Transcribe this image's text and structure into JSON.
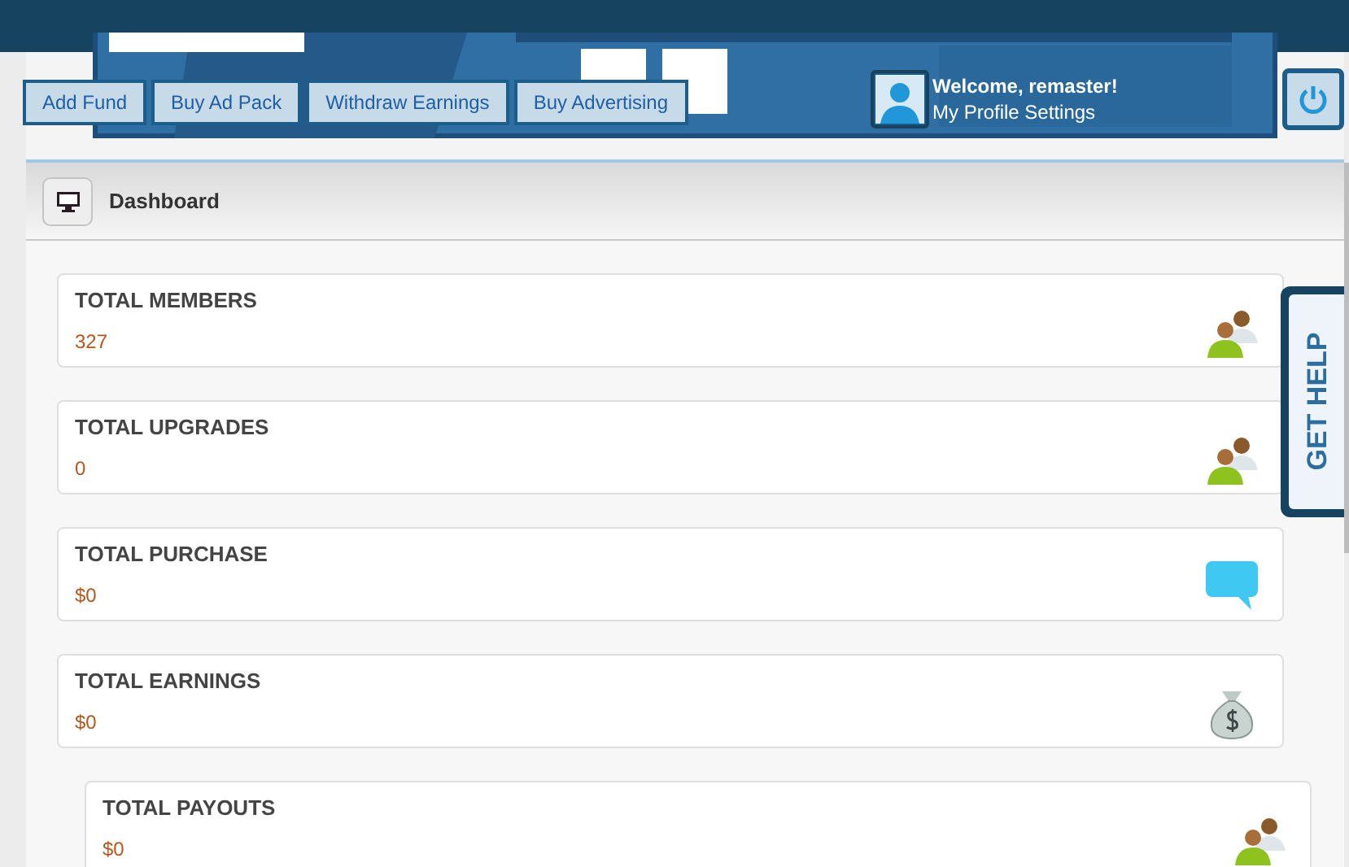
{
  "header": {
    "nav_buttons": [
      "Add Fund",
      "Buy Ad Pack",
      "Withdraw Earnings",
      "Buy Advertising"
    ],
    "welcome": "Welcome, remaster!",
    "profile_link": "My Profile Settings"
  },
  "breadcrumb": {
    "title": "Dashboard"
  },
  "stats": [
    {
      "label": "TOTAL MEMBERS",
      "value": "327",
      "kind": "people"
    },
    {
      "label": "TOTAL UPGRADES",
      "value": "0",
      "kind": "people"
    },
    {
      "label": "TOTAL PURCHASE",
      "value": "$0",
      "kind": "chat"
    },
    {
      "label": "TOTAL EARNINGS",
      "value": "$0",
      "kind": "money"
    },
    {
      "label": "TOTAL PAYOUTS",
      "value": "$0",
      "kind": "people"
    }
  ],
  "help_tab": "GET HELP"
}
